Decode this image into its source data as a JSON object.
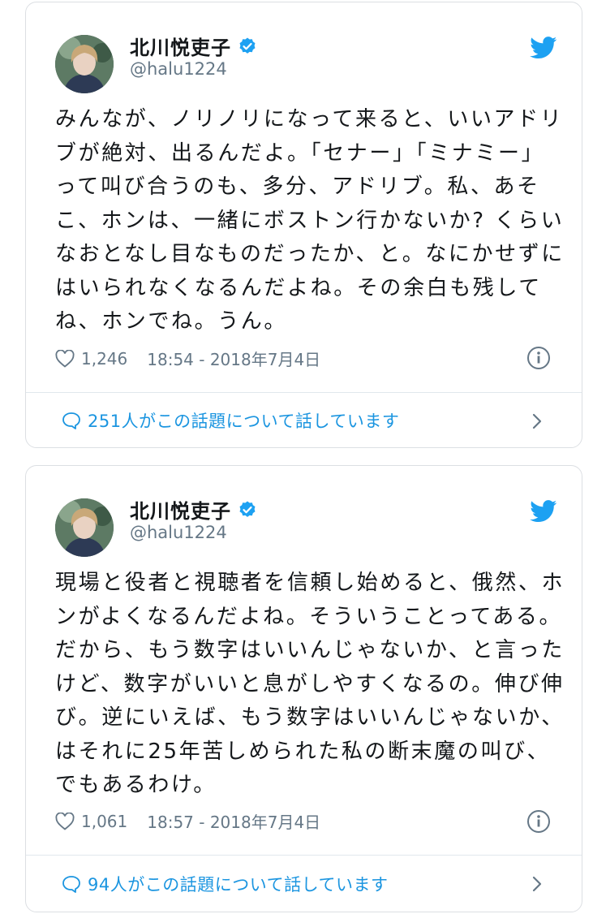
{
  "tweets": [
    {
      "user_name": "北川悦吏子",
      "handle": "@halu1224",
      "lines": [
        "みんなが、ノリノリになって来ると、いいアドリ",
        "ブが絶対、出るんだよ。「セナー」「ミナミー」",
        "って叫び合うのも、多分、アドリブ。私、あそ",
        "こ、ホンは、一緒にボストン行かないか? くらい",
        "なおとなし目なものだったか、と。なにかせずに",
        "はいられなくなるんだよね。その余白も残して",
        "ね、ホンでね。うん。"
      ],
      "likes": "1,246",
      "timestamp": "18:54 - 2018年7月4日",
      "conversation": "251人がこの話題について話しています"
    },
    {
      "user_name": "北川悦吏子",
      "handle": "@halu1224",
      "lines": [
        "現場と役者と視聴者を信頼し始めると、俄然、ホ",
        "ンがよくなるんだよね。そういうことってある。",
        "だから、もう数字はいいんじゃないか、と言った",
        "けど、数字がいいと息がしやすくなるの。伸び伸",
        "び。逆にいえば、もう数字はいいんじゃないか、",
        "はそれに25年苦しめられた私の断末魔の叫び、",
        "でもあるわけ。"
      ],
      "likes": "1,061",
      "timestamp": "18:57 - 2018年7月4日",
      "conversation": "94人がこの話題について話しています"
    }
  ],
  "colors": {
    "accent": "#1da1f2",
    "link": "#1b95e0",
    "muted": "#657786",
    "text": "#14171a"
  }
}
